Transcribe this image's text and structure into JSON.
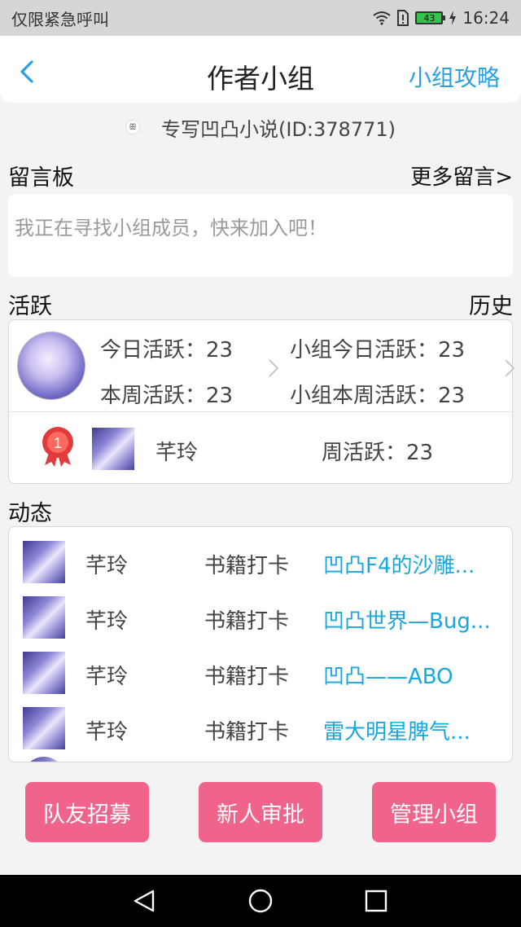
{
  "status_bar": {
    "carrier": "仅限紧急呼叫",
    "battery": "43",
    "time": "16:24",
    "icons": [
      "wifi-icon",
      "sim-alert-icon",
      "battery-icon",
      "charging-icon"
    ]
  },
  "header": {
    "title": "作者小组",
    "right_link": "小组攻略",
    "back_icon": "chevron-left-icon"
  },
  "group": {
    "name": "专写凹凸小说(ID:378771)"
  },
  "message_board": {
    "title": "留言板",
    "more": "更多留言>",
    "placeholder": "我正在寻找小组成员，快来加入吧！"
  },
  "activity": {
    "title": "活跃",
    "history": "历史",
    "today": "今日活跃：23",
    "week": "本周活跃：23",
    "group_today": "小组今日活跃：23",
    "group_week": "小组本周活跃：23",
    "ranking": {
      "rank": "1",
      "name": "芊玲",
      "weekly": "周活跃：23"
    }
  },
  "feed": {
    "title": "动态",
    "items": [
      {
        "name": "芊玲",
        "action": "书籍打卡",
        "book": "凹凸F4的沙雕..."
      },
      {
        "name": "芊玲",
        "action": "书籍打卡",
        "book": "凹凸世界—Bug..."
      },
      {
        "name": "芊玲",
        "action": "书籍打卡",
        "book": "凹凸——ABO"
      },
      {
        "name": "芊玲",
        "action": "书籍打卡",
        "book": "雷大明星脾气..."
      }
    ]
  },
  "buttons": {
    "recruit": "队友招募",
    "approve": "新人审批",
    "manage": "管理小组"
  },
  "colors": {
    "accent_blue": "#2aa0e0",
    "link_blue": "#1aa7dd",
    "button_pink": "#f0648c",
    "badge_red": "#e23b3b"
  }
}
